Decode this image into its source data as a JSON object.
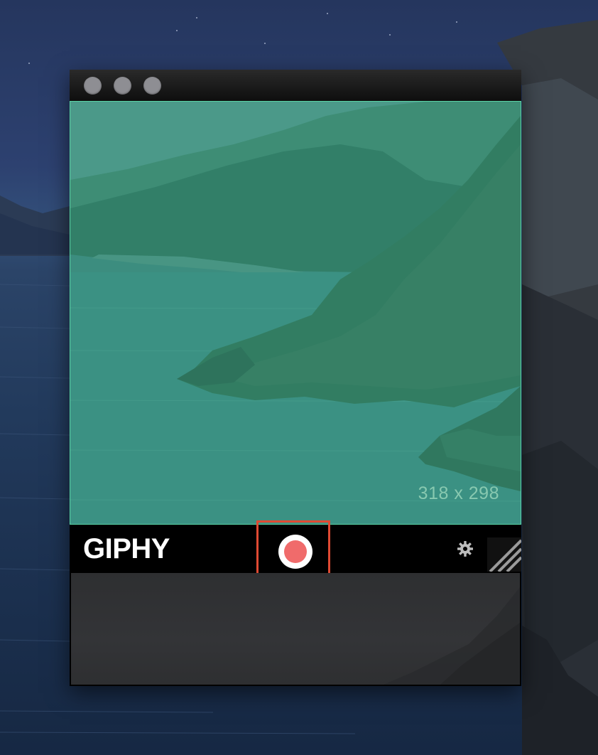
{
  "app": {
    "logo_text": "GIPHY"
  },
  "capture": {
    "dimensions_label": "318 x 298"
  },
  "colors": {
    "capture_border": "#5ad3a6",
    "record_dot": "#f06b6b",
    "highlight": "#e04a33",
    "traffic_light": "#8e8e93"
  },
  "icons": {
    "close": "circle-gray",
    "minimize": "circle-gray",
    "zoom": "circle-gray",
    "record": "record-dot-icon",
    "settings": "gear-icon",
    "resize": "resize-grip-icon"
  }
}
